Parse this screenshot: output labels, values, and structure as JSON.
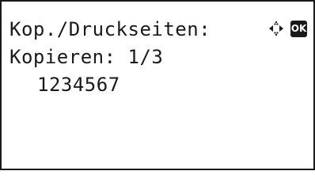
{
  "screen": {
    "title_line": "Kop./Druckseiten:",
    "copy_line": "Kopieren: 1/3",
    "value_line": "1234567",
    "icons": {
      "navigation": "arrow-keys-icon",
      "ok": "ok-key-icon"
    },
    "ok_label": "OK"
  }
}
